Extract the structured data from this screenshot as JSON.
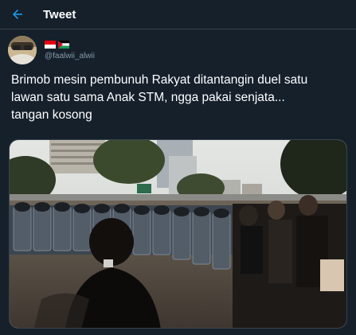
{
  "header": {
    "title": "Tweet",
    "back_icon": "arrow-left-icon",
    "accent": "#1da1f2"
  },
  "author": {
    "handle": "@faalwii_alwii",
    "name_flags": [
      "indonesia-flag-icon",
      "palestine-flag-icon"
    ]
  },
  "tweet": {
    "text": "Brimob mesin pembunuh Rakyat ditantangin duel satu\nlawan satu sama Anak STM, ngga pakai senjata...\ntangan kosong"
  },
  "media": {
    "kind": "photo"
  },
  "colors": {
    "background": "#15202b",
    "divider": "#38444d",
    "secondary_text": "#8899a6"
  }
}
